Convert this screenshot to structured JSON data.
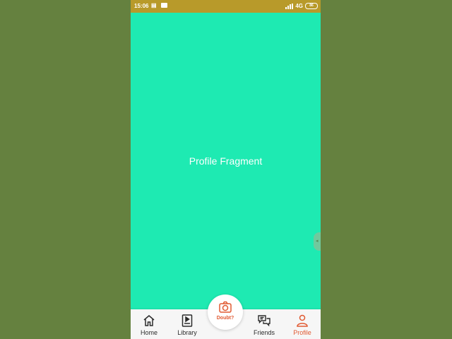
{
  "status_bar": {
    "time": "15:06",
    "network": "4G",
    "battery": "86"
  },
  "content": {
    "label": "Profile Fragment"
  },
  "bottom_nav": {
    "items": [
      {
        "label": "Home",
        "icon": "home-icon"
      },
      {
        "label": "Library",
        "icon": "video-library-icon"
      },
      {
        "label": "Friends",
        "icon": "chat-bubbles-icon"
      },
      {
        "label": "Profile",
        "icon": "person-icon",
        "active": true
      }
    ],
    "fab": {
      "label": "Doubt?",
      "icon": "camera-icon"
    }
  },
  "colors": {
    "accent": "#e15a32",
    "content_bg": "#1eeab2",
    "status_bar_bg": "#b89a2a",
    "page_bg": "#65813f"
  }
}
